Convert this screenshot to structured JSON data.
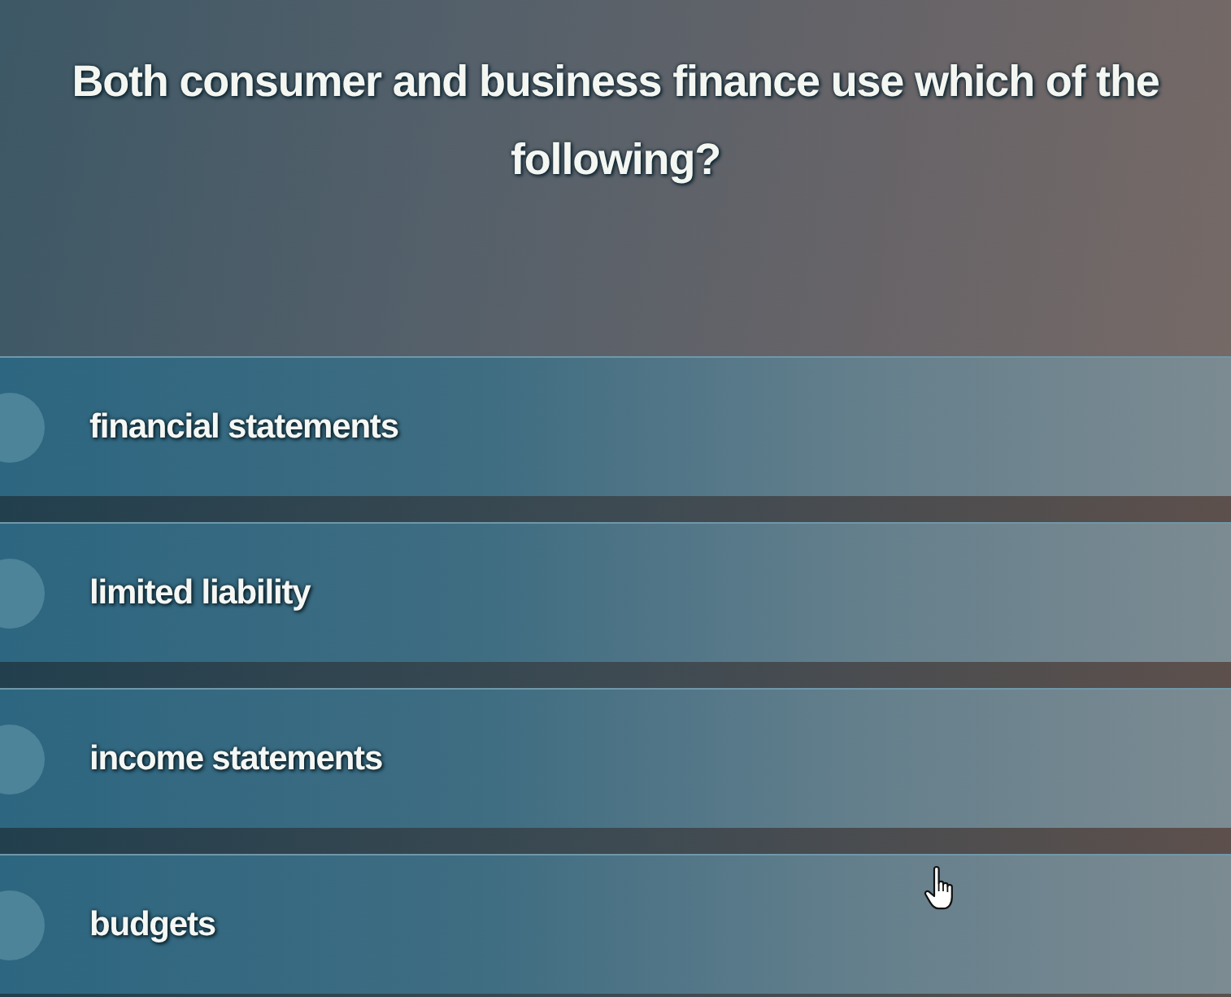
{
  "question": {
    "text": "Both consumer and business finance use which of the following?"
  },
  "options": [
    {
      "label": "financial statements",
      "selected": false
    },
    {
      "label": "limited liability",
      "selected": false
    },
    {
      "label": "income statements",
      "selected": false
    },
    {
      "label": "budgets",
      "selected": false
    }
  ]
}
